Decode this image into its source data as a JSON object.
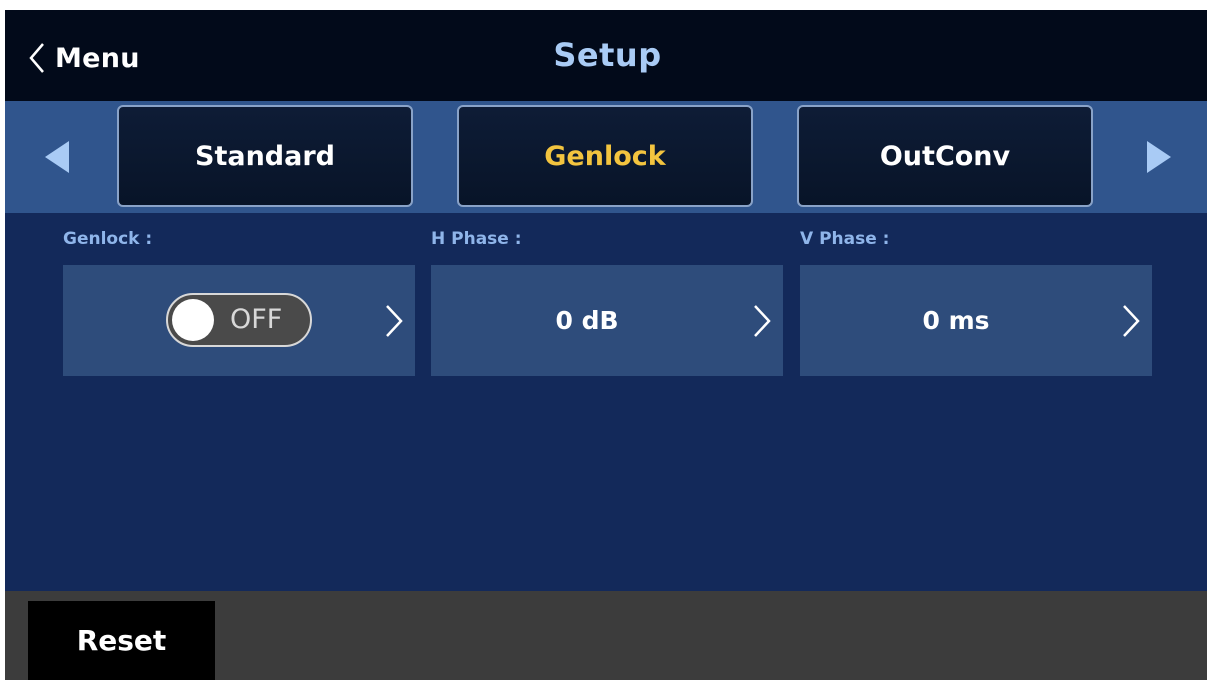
{
  "header": {
    "back_label": "Menu",
    "title": "Setup"
  },
  "tabs": [
    {
      "label": "Standard",
      "active": false
    },
    {
      "label": "Genlock",
      "active": true
    },
    {
      "label": "OutConv",
      "active": false
    }
  ],
  "params": [
    {
      "label": "Genlock :",
      "type": "toggle",
      "value": "OFF",
      "on": false
    },
    {
      "label": "H Phase :",
      "type": "value",
      "value": "0 dB"
    },
    {
      "label": "V Phase :",
      "type": "value",
      "value": "0 ms"
    }
  ],
  "footer": {
    "reset_label": "Reset"
  },
  "colors": {
    "header_bg": "#020a1a",
    "title": "#a9cbf5",
    "tabbar_bg": "#30558d",
    "active_tab_text": "#f3c43f",
    "content_bg": "#13295a",
    "param_box": "#2e4c7b",
    "param_label": "#8fb5ea",
    "footer_bg": "#3c3c3c"
  },
  "icons": [
    "chevron-left-icon",
    "arrow-left-icon",
    "arrow-right-icon",
    "chevron-right-icon"
  ]
}
